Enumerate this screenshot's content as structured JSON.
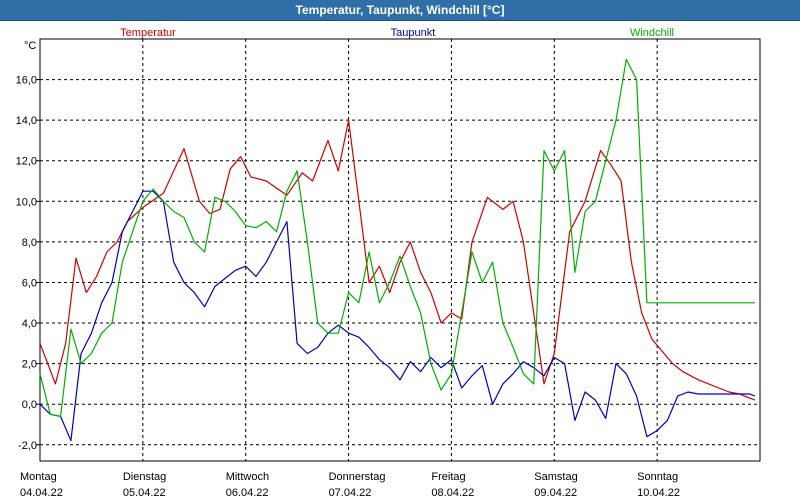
{
  "title": "Temperatur, Taupunkt, Windchill [°C]",
  "chart_data": {
    "type": "line",
    "title": "Temperatur, Taupunkt, Windchill [°C]",
    "ylabel": "°C",
    "xlabel": "",
    "ylim": [
      -2.8,
      18.0
    ],
    "xlim": [
      0,
      7
    ],
    "y_ticks": [
      "-2,0",
      "0,0",
      "2,0",
      "4,0",
      "6,0",
      "8,0",
      "10,0",
      "12,0",
      "14,0",
      "16,0"
    ],
    "y_tick_values": [
      -2,
      0,
      2,
      4,
      6,
      8,
      10,
      12,
      14,
      16
    ],
    "x_ticks": [
      {
        "day": "Montag",
        "date": "04.04.22"
      },
      {
        "day": "Dienstag",
        "date": "05.04.22"
      },
      {
        "day": "Mittwoch",
        "date": "06.04.22"
      },
      {
        "day": "Donnerstag",
        "date": "07.04.22"
      },
      {
        "day": "Freitag",
        "date": "08.04.22"
      },
      {
        "day": "Samstag",
        "date": "09.04.22"
      },
      {
        "day": "Sonntag",
        "date": "10.04.22"
      }
    ],
    "grid": true,
    "legend": "top",
    "series": [
      {
        "name": "Temperatur",
        "color": "#d40000",
        "x": [
          0,
          0.15,
          0.25,
          0.35,
          0.45,
          0.55,
          0.65,
          0.75,
          0.85,
          1.0,
          1.2,
          1.4,
          1.55,
          1.65,
          1.75,
          1.85,
          1.95,
          2.05,
          2.2,
          2.4,
          2.55,
          2.65,
          2.8,
          2.9,
          3.0,
          3.1,
          3.2,
          3.3,
          3.4,
          3.5,
          3.6,
          3.7,
          3.8,
          3.9,
          4.0,
          4.1,
          4.2,
          4.35,
          4.5,
          4.6,
          4.7,
          4.8,
          4.9,
          5.0,
          5.15,
          5.3,
          5.45,
          5.55,
          5.65,
          5.75,
          5.85,
          5.95,
          6.05,
          6.15,
          6.25,
          6.4,
          6.5,
          6.6,
          6.7,
          6.8,
          6.9,
          6.95
        ],
        "y": [
          3.0,
          1.0,
          3.0,
          7.2,
          5.5,
          6.3,
          7.5,
          8.0,
          9.0,
          9.7,
          10.4,
          12.6,
          10.0,
          9.4,
          9.6,
          11.6,
          12.2,
          11.2,
          11.0,
          10.3,
          11.4,
          11.0,
          13.0,
          11.5,
          14.0,
          10.0,
          6.0,
          6.8,
          5.5,
          7.0,
          8.0,
          6.5,
          5.5,
          4.0,
          4.5,
          4.2,
          8.0,
          10.2,
          9.6,
          10.0,
          8.0,
          4.5,
          1.0,
          2.5,
          8.5,
          10.0,
          12.5,
          11.8,
          11.0,
          7.0,
          4.5,
          3.2,
          2.6,
          2.0,
          1.6,
          1.2,
          1.0,
          0.8,
          0.6,
          0.5,
          0.3,
          0.2
        ]
      },
      {
        "name": "Taupunkt",
        "color": "#0000c0",
        "x": [
          0,
          0.1,
          0.2,
          0.3,
          0.4,
          0.5,
          0.6,
          0.7,
          0.8,
          0.9,
          1.0,
          1.1,
          1.2,
          1.3,
          1.4,
          1.5,
          1.6,
          1.7,
          1.8,
          1.9,
          2.0,
          2.1,
          2.2,
          2.3,
          2.4,
          2.5,
          2.6,
          2.7,
          2.8,
          2.9,
          3.0,
          3.1,
          3.2,
          3.3,
          3.4,
          3.5,
          3.6,
          3.7,
          3.8,
          3.9,
          4.0,
          4.1,
          4.2,
          4.3,
          4.4,
          4.5,
          4.6,
          4.7,
          4.8,
          4.9,
          5.0,
          5.1,
          5.2,
          5.3,
          5.4,
          5.5,
          5.6,
          5.7,
          5.8,
          5.9,
          6.0,
          6.1,
          6.2,
          6.3,
          6.4,
          6.5,
          6.6,
          6.7,
          6.8,
          6.9,
          6.95
        ],
        "y": [
          0.0,
          -0.5,
          -0.6,
          -1.8,
          2.5,
          3.5,
          5.0,
          6.0,
          8.5,
          9.5,
          10.5,
          10.5,
          10.0,
          7.0,
          6.0,
          5.5,
          4.8,
          5.8,
          6.2,
          6.6,
          6.8,
          6.3,
          7.0,
          8.0,
          9.0,
          3.0,
          2.5,
          2.8,
          3.5,
          3.9,
          3.5,
          3.3,
          2.8,
          2.2,
          1.8,
          1.2,
          2.1,
          1.6,
          2.3,
          1.8,
          2.2,
          0.8,
          1.4,
          1.9,
          0.0,
          1.0,
          1.5,
          2.1,
          1.8,
          1.4,
          2.3,
          2.0,
          -0.8,
          0.6,
          0.2,
          -0.7,
          2.0,
          1.5,
          0.4,
          -1.6,
          -1.3,
          -0.8,
          0.4,
          0.6,
          0.5,
          0.5,
          0.5,
          0.5,
          0.5,
          0.5,
          0.4
        ]
      },
      {
        "name": "Windchill",
        "color": "#00b000",
        "x": [
          0,
          0.1,
          0.2,
          0.3,
          0.4,
          0.5,
          0.6,
          0.7,
          0.8,
          0.9,
          1.0,
          1.1,
          1.2,
          1.3,
          1.4,
          1.5,
          1.6,
          1.7,
          1.8,
          1.9,
          2.0,
          2.1,
          2.2,
          2.3,
          2.4,
          2.5,
          2.6,
          2.7,
          2.8,
          2.9,
          3.0,
          3.1,
          3.2,
          3.3,
          3.4,
          3.5,
          3.6,
          3.7,
          3.8,
          3.9,
          4.0,
          4.1,
          4.2,
          4.3,
          4.4,
          4.5,
          4.6,
          4.7,
          4.8,
          4.9,
          5.0,
          5.1,
          5.2,
          5.3,
          5.4,
          5.5,
          5.6,
          5.7,
          5.8,
          5.9,
          6.0,
          6.1,
          6.2,
          6.3,
          6.4,
          6.5,
          6.6,
          6.7,
          6.8,
          6.9,
          6.95
        ],
        "y": [
          1.5,
          -0.5,
          -0.6,
          3.7,
          2.0,
          2.5,
          3.5,
          4.0,
          7.0,
          8.5,
          10.0,
          10.6,
          10.0,
          9.5,
          9.2,
          8.0,
          7.5,
          10.2,
          10.0,
          9.5,
          8.8,
          8.7,
          9.0,
          8.5,
          10.5,
          11.5,
          8.0,
          4.0,
          3.5,
          3.5,
          5.5,
          5.0,
          7.5,
          5.0,
          6.0,
          7.3,
          5.8,
          4.5,
          2.0,
          0.7,
          1.5,
          4.5,
          7.5,
          6.0,
          7.0,
          4.0,
          2.8,
          1.5,
          1.0,
          12.5,
          11.5,
          12.5,
          6.5,
          9.5,
          10.0,
          12.0,
          14.0,
          17.0,
          16.0,
          5.0,
          5.0,
          5.0,
          5.0,
          5.0,
          5.0,
          5.0,
          5.0,
          5.0,
          5.0,
          5.0,
          5.0
        ]
      }
    ]
  }
}
